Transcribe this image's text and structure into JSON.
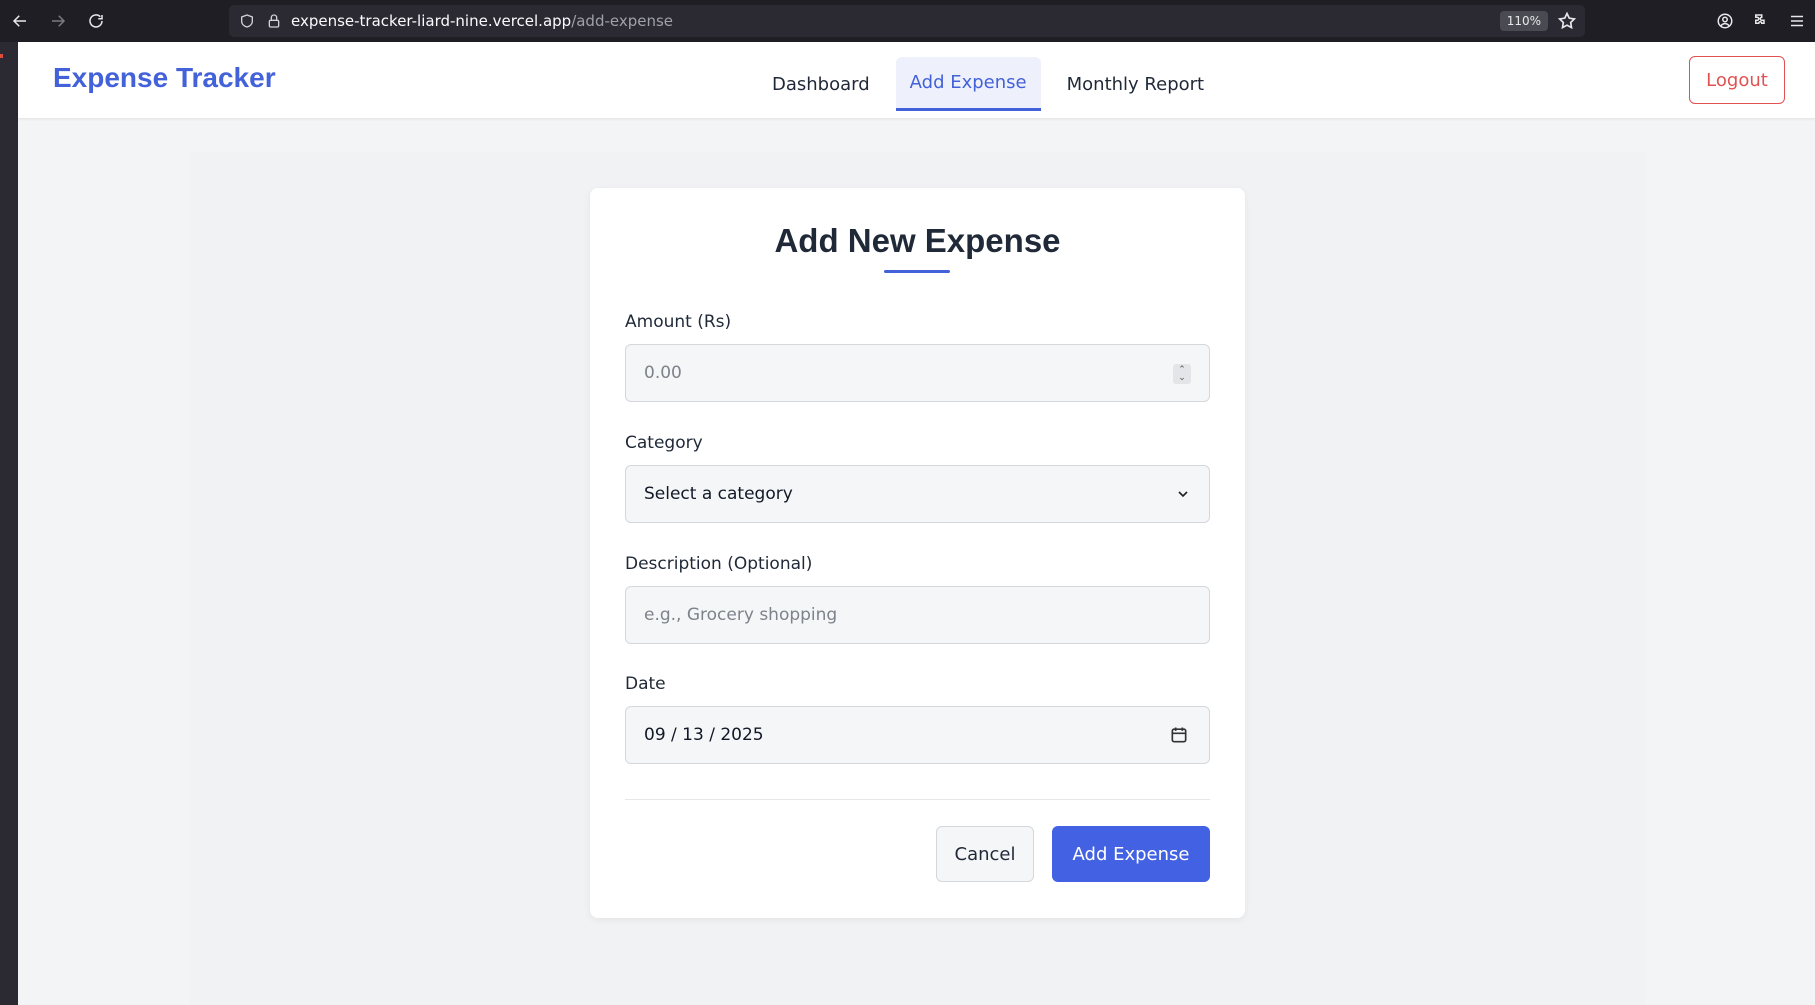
{
  "browser": {
    "url_host": "expense-tracker-liard-nine.vercel.app",
    "url_path": "/add-expense",
    "zoom": "110%"
  },
  "nav": {
    "brand": "Expense Tracker",
    "links": [
      {
        "label": "Dashboard",
        "active": false
      },
      {
        "label": "Add Expense",
        "active": true
      },
      {
        "label": "Monthly Report",
        "active": false
      }
    ],
    "logout_label": "Logout"
  },
  "form": {
    "title": "Add New Expense",
    "amount": {
      "label": "Amount (Rs)",
      "placeholder": "0.00"
    },
    "category": {
      "label": "Category",
      "value": "Select a category"
    },
    "description": {
      "label": "Description (Optional)",
      "placeholder": "e.g., Grocery shopping"
    },
    "date": {
      "label": "Date",
      "value": "09 / 13 / 2025"
    },
    "cancel_label": "Cancel",
    "submit_label": "Add Expense"
  },
  "colors": {
    "accent": "#4361d8",
    "primary_button": "#4361e3",
    "danger": "#e05252"
  }
}
